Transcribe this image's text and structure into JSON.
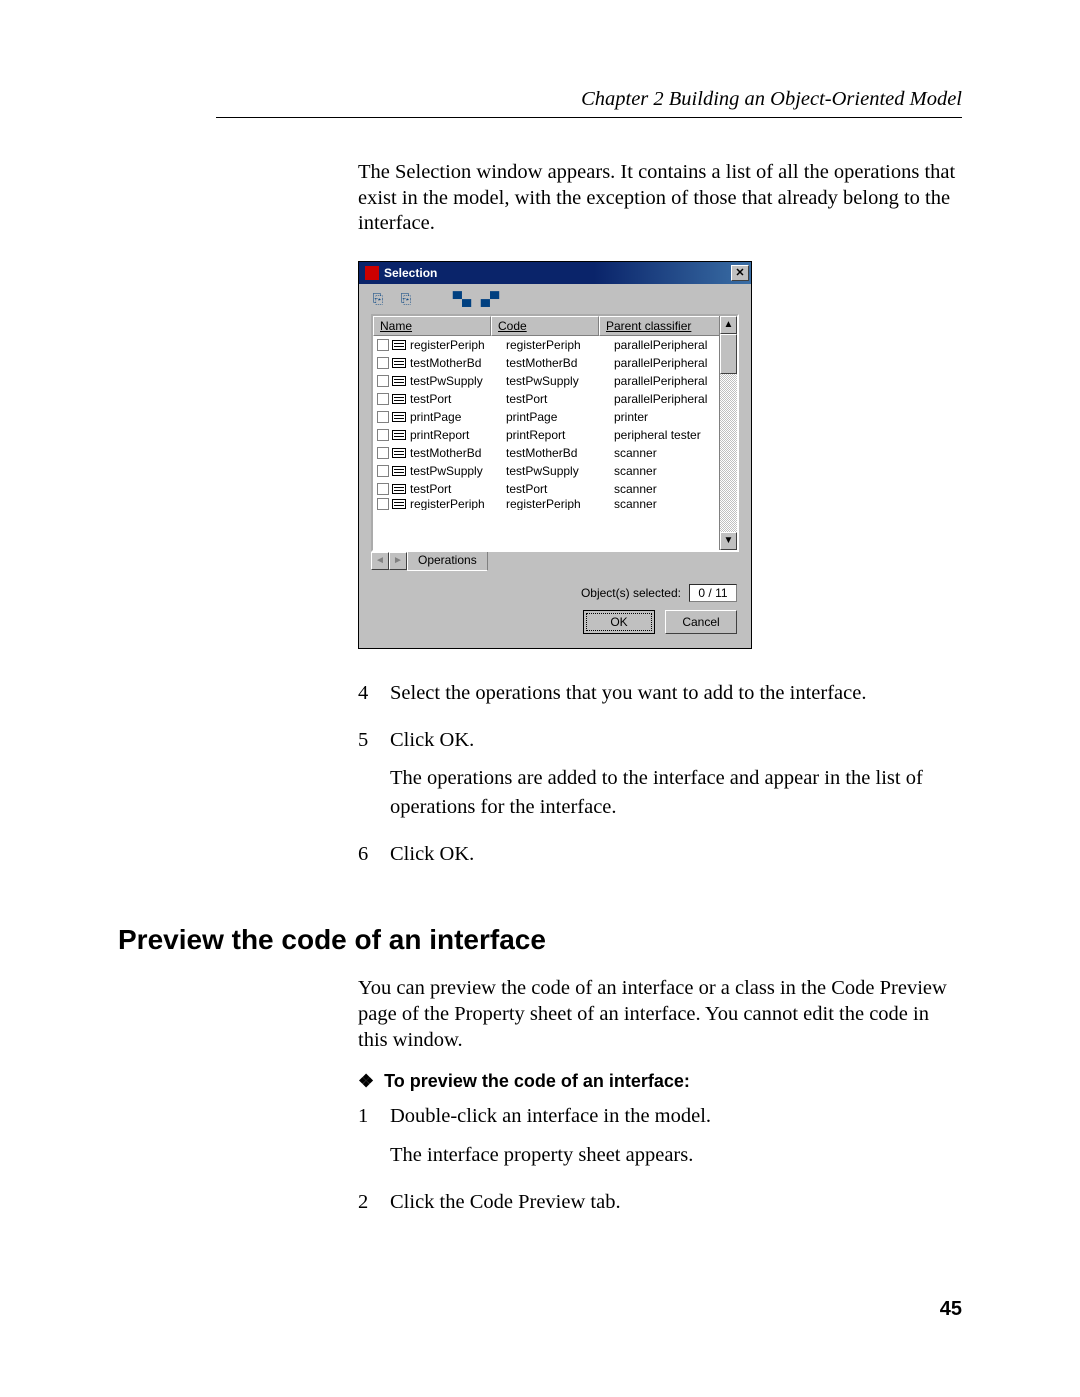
{
  "header": {
    "running_head": "Chapter 2   Building an Object-Oriented Model"
  },
  "intro_para": "The Selection window appears. It contains a list of all the operations that exist in the model, with the exception of those that already belong to the interface.",
  "dialog": {
    "title": "Selection",
    "columns": {
      "name": "Name",
      "code": "Code",
      "parent": "Parent classifier"
    },
    "rows": [
      {
        "name": "registerPeriph",
        "code": "registerPeriph",
        "parent": "parallelPeripheral"
      },
      {
        "name": "testMotherBd",
        "code": "testMotherBd",
        "parent": "parallelPeripheral"
      },
      {
        "name": "testPwSupply",
        "code": "testPwSupply",
        "parent": "parallelPeripheral"
      },
      {
        "name": "testPort",
        "code": "testPort",
        "parent": "parallelPeripheral"
      },
      {
        "name": "printPage",
        "code": "printPage",
        "parent": "printer"
      },
      {
        "name": "printReport",
        "code": "printReport",
        "parent": "peripheral tester"
      },
      {
        "name": "testMotherBd",
        "code": "testMotherBd",
        "parent": "scanner"
      },
      {
        "name": "testPwSupply",
        "code": "testPwSupply",
        "parent": "scanner"
      },
      {
        "name": "testPort",
        "code": "testPort",
        "parent": "scanner"
      },
      {
        "name": "registerPeriph",
        "code": "registerPeriph",
        "parent": "scanner"
      }
    ],
    "tab": "Operations",
    "status_label": "Object(s) selected:",
    "status_count": "0 / 11",
    "ok": "OK",
    "cancel": "Cancel"
  },
  "steps_a": [
    {
      "n": "4",
      "lines": [
        "Select the operations that you want to add to the interface."
      ]
    },
    {
      "n": "5",
      "lines": [
        "Click OK.",
        "The operations are added to the interface and appear in the list of operations for the interface."
      ]
    },
    {
      "n": "6",
      "lines": [
        "Click OK."
      ]
    }
  ],
  "section_heading": "Preview the code of an interface",
  "section_para": "You can preview the code of an interface or a class in the Code Preview page of the Property sheet of an interface. You cannot edit the code in this window.",
  "procedure_heading": "To preview the code of an interface:",
  "steps_b": [
    {
      "n": "1",
      "lines": [
        "Double-click an interface in the model.",
        "The interface property sheet appears."
      ]
    },
    {
      "n": "2",
      "lines": [
        "Click the Code Preview tab."
      ]
    }
  ],
  "page_number": "45"
}
